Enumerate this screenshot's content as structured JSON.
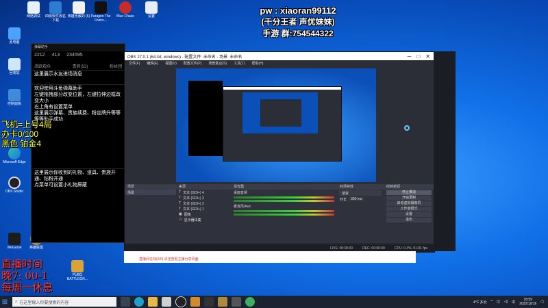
{
  "desktop_icons": [
    {
      "label": "此电脑"
    },
    {
      "label": "回收站"
    },
    {
      "label": "控制面板"
    },
    {
      "label": "Microsoft Edge"
    },
    {
      "label": "OBS Studio"
    },
    {
      "label": "WeGame"
    },
    {
      "label": "英雄联盟"
    },
    {
      "label": "PUBG BATTLEGR..."
    }
  ],
  "top_icons": [
    {
      "label": "网络调试"
    },
    {
      "label": "四级软件改名下载"
    },
    {
      "label": "英雄无敌的 (6)"
    },
    {
      "label": "Paragon The Overs..."
    },
    {
      "label": "Blue Chase"
    },
    {
      "label": "设置"
    }
  ],
  "overlay": {
    "pw_line": "pw : xiaoran99112",
    "line2": "(千分王者 声优妹妹)",
    "line3": "手游 群:754544322",
    "left_yellow": [
      "飞机=上号4局",
      "办卡0/100",
      "黑色 铂金4"
    ],
    "left_red": [
      "直播时间",
      "晚7: 00-1",
      "每周一休息"
    ]
  },
  "chat": {
    "title": "弹幕助手",
    "stats": [
      "2212",
      "413",
      "234595"
    ],
    "tabs": [
      "活跃观众",
      "贵宾(53)",
      "粉丝团"
    ],
    "messages": [
      "这里展示水友进场消息",
      "欢迎使用斗鱼弹幕助手\n左键拖拽部分改变位置，左键拉伸边框改变大小\n右上角有设置菜单\n这里展示弹幕、贵族续费、粉丝牌升等等\n等等助手成功",
      "这里展示你收到的礼物、道具、贵族开通、钻粉开通\n点菜单可设置小礼物屏蔽"
    ]
  },
  "obs": {
    "title": "OBS 27.0.1 (64-bit, windows) - 配置文件: 未命名 - 场景: 未命名",
    "menu": [
      "文件(F)",
      "编辑(E)",
      "视图(V)",
      "配置文件(P)",
      "场景集合(S)",
      "工具(T)",
      "帮助(H)"
    ],
    "dock_titles": [
      "场景",
      "来源",
      "混音器",
      "转场特效",
      "控制按钮"
    ],
    "scenes": [
      "场景"
    ],
    "sources": [
      "文本 (GDI+) 4",
      "文本 (GDI+) 3",
      "文本 (GDI+) 2",
      "文本 (GDI+) 1",
      "图像",
      "显示器采集"
    ],
    "mixer": [
      "桌面音频",
      "麦克风/Aux"
    ],
    "transition": [
      "渐变",
      "时长",
      "300 ms"
    ],
    "controls": [
      "停止推流",
      "开始录制",
      "启动虚拟摄像机",
      "工作室模式",
      "设置",
      "退出"
    ],
    "status": [
      "LIVE: 00:00:00",
      "REC: 00:00:00",
      "CPU: 0.4%, 51.81 fps"
    ]
  },
  "whitebar_text": "直播间在线(0/0)   点击查看主播分享页面",
  "taskbar": {
    "search_placeholder": "在这里输入你要搜索的内容",
    "weather": "4°C 多云",
    "time": "18:59",
    "date": "2022/12/16",
    "lang": "中"
  },
  "colors": {
    "desktop": "#1170e8",
    "obs_bg": "#2b2d37",
    "taskbar": "#1b2332",
    "chat_yellow": "#ffff33",
    "chat_red": "#ff3333"
  }
}
